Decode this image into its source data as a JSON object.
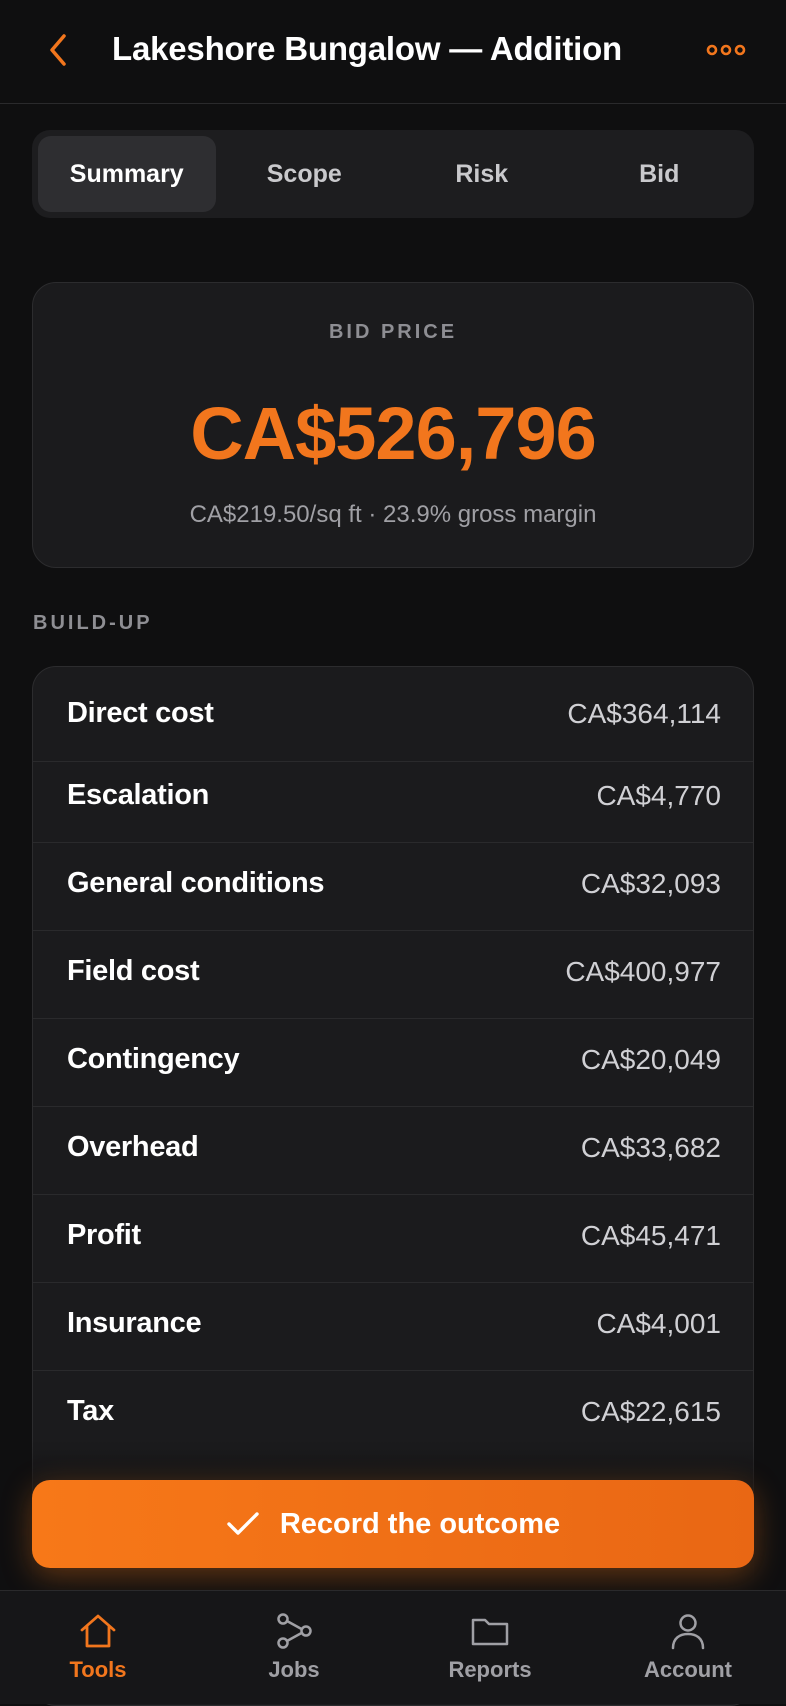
{
  "header": {
    "title": "Lakeshore Bungalow — Addition"
  },
  "tabs": [
    {
      "label": "Summary",
      "active": true
    },
    {
      "label": "Scope"
    },
    {
      "label": "Risk"
    },
    {
      "label": "Bid"
    }
  ],
  "bid": {
    "label": "BID PRICE",
    "price": "CA$526,796",
    "subtitle": "CA$219.50/sq ft · 23.9% gross margin"
  },
  "buildup": {
    "section_label": "BUILD-UP",
    "rows": [
      {
        "label": "Direct cost",
        "value": "CA$364,114"
      },
      {
        "label": "Escalation",
        "value": "CA$4,770"
      },
      {
        "label": "General conditions",
        "value": "CA$32,093"
      },
      {
        "label": "Field cost",
        "value": "CA$400,977"
      },
      {
        "label": "Contingency",
        "value": "CA$20,049"
      },
      {
        "label": "Overhead",
        "value": "CA$33,682"
      },
      {
        "label": "Profit",
        "value": "CA$45,471"
      },
      {
        "label": "Insurance",
        "value": "CA$4,001"
      },
      {
        "label": "Tax",
        "value": "CA$22,615"
      }
    ]
  },
  "cta": {
    "label": "Record the outcome",
    "icon": "checkmark-icon"
  },
  "bottom_nav": [
    {
      "label": "Tools",
      "icon": "home-icon",
      "active": true
    },
    {
      "label": "Jobs",
      "icon": "branch-icon"
    },
    {
      "label": "Reports",
      "icon": "folder-icon"
    },
    {
      "label": "Account",
      "icon": "person-icon"
    }
  ],
  "colors": {
    "accent": "#f2761d",
    "background": "#0f0f10",
    "card": "#1b1b1d"
  }
}
